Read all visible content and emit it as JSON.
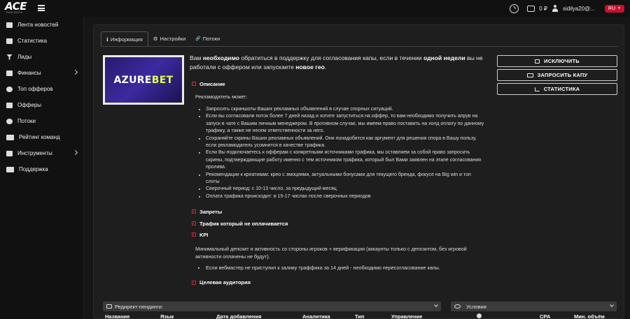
{
  "header": {
    "logo_main_a": "ACE",
    "logo_sub": "PARTNERS",
    "balance": "0 ₽",
    "username": "sidilya20@...",
    "lang": "RU"
  },
  "sidebar": {
    "items": [
      {
        "label": "Лента новостей",
        "icon": "news-icon",
        "arrow": false
      },
      {
        "label": "Статистика",
        "icon": "chart-icon",
        "arrow": false
      },
      {
        "label": "Лиды",
        "icon": "filter-icon",
        "arrow": false
      },
      {
        "label": "Финансы",
        "icon": "money-icon",
        "arrow": true
      },
      {
        "label": "Топ офферов",
        "icon": "medal-icon",
        "arrow": false
      },
      {
        "label": "Офферы",
        "icon": "offer-icon",
        "arrow": false
      },
      {
        "label": "Потоки",
        "icon": "link-icon",
        "arrow": false
      },
      {
        "label": "Рейтинг команд",
        "icon": "rating-icon",
        "arrow": false
      },
      {
        "label": "Инструменты",
        "icon": "tools-icon",
        "arrow": true
      },
      {
        "label": "Поддержка",
        "icon": "support-icon",
        "arrow": false
      }
    ]
  },
  "tabs": [
    {
      "label": "Информация",
      "glyph": "ℹ"
    },
    {
      "label": "Настройки",
      "glyph": "⚙"
    },
    {
      "label": "Потоки",
      "glyph": "🔗"
    }
  ],
  "banner": {
    "text_a": "AZURE",
    "text_b": "BET"
  },
  "notice": {
    "p1": "Вам ",
    "b1": "необходимо",
    "p2": " обратиться в поддержку для согласования капы, если в течении ",
    "b2": "одной недели",
    "p3": " вы не работали с оффером или запускаете ",
    "b3": "новое гео",
    "p4": "."
  },
  "actions": {
    "exclude": "ИСКЛЮЧИТЬ",
    "request_cap": "ЗАПРОСИТЬ КАПУ",
    "statistics": "СТАТИСТИКА"
  },
  "description": {
    "title": "Описание",
    "intro": "Рекламодатель может:",
    "bullets": [
      "Запросить скриншоты Ваших рекламных объявлений в случае спорных ситуаций.",
      "Если вы согласовали поток более 7 дней назад и хотите запуститься на оффер, то вам необходимо получить апрув на запуск в чате с Вашим личным менеджером. В противном случае, мы имеем право поставить на холд оплату по данному трафику, а также не несем ответственности за него.",
      "Сохраняйте скрины Ваших рекламных объявлений. Они понадобятся как аргумент для решения спора в Вашу пользу, если рекламодатель усомнится в качестве трафика.",
      "Если Вы подключаетесь к офферам с конкретными источниками трафика, мы оставляем за собой право запросить скрины, подтверждающие работу именно с тем источником трафика, который был Вами заявлен на этапе согласования пролива.",
      "Рекомендации к креативам: крео с эмоциями, актуальными бонусами для текущего бренда, фокусе на Big win и топ слоты",
      "Сверочный период: с 10-13 число, за предыдущий месяц",
      "Оплата трафика происходит: в 15-17 числах после сверочных периодов"
    ]
  },
  "sections": {
    "bans": "Запреты",
    "unpaid": "Трафик который не оплачивается",
    "kpi": "KPI",
    "kpi_text": "Минимальный депозит и активность со стороны игроков + верификация (аккаунты только с депозитом, без игровой активности оплачены не будут).",
    "kpi_bullet": "Если вебмастер не приступил к заливу траффика за 14 дней - необходимо пересогласование капы.",
    "audience": "Целевая аудитория"
  },
  "filters": {
    "redirect": "Редирект-пендинги:",
    "conditions": "Условия"
  },
  "table": {
    "headers": [
      "Название",
      "Язык",
      "Дата добавления",
      "Аналитика",
      "Тип",
      "Управление",
      "",
      "CPA",
      "Мин. объём"
    ]
  }
}
